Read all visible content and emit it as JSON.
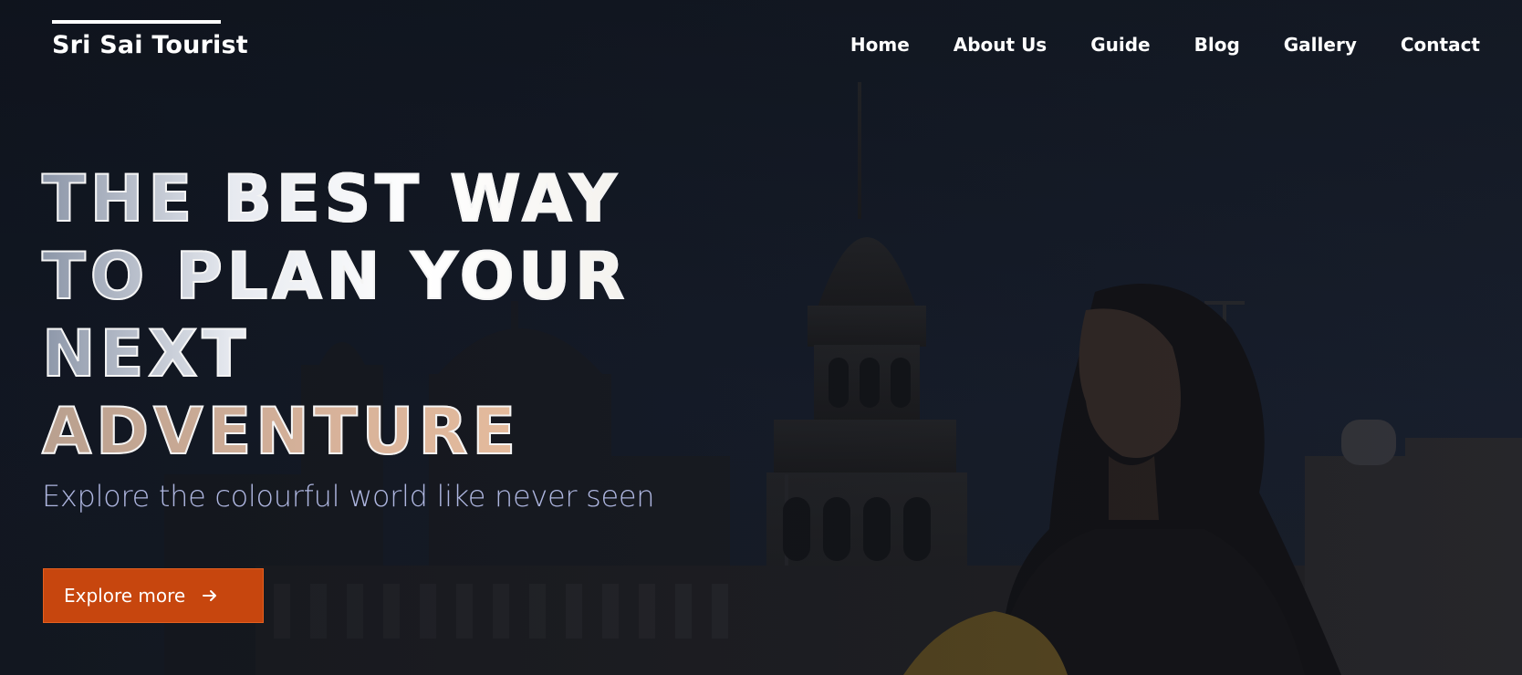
{
  "brand": {
    "name": "Sri Sai Tourist"
  },
  "nav": {
    "items": [
      {
        "label": "Home"
      },
      {
        "label": "About Us"
      },
      {
        "label": "Guide"
      },
      {
        "label": "Blog"
      },
      {
        "label": "Gallery"
      },
      {
        "label": "Contact"
      }
    ]
  },
  "hero": {
    "title_lines": [
      "THE BEST WAY",
      "TO PLAN YOUR",
      "NEXT",
      "ADVENTURE"
    ],
    "subtitle": "Explore the colourful world like never seen",
    "cta_label": "Explore more",
    "cta_icon": "arrow-right-icon"
  },
  "colors": {
    "accent": "#c7460e",
    "subtitle": "#aeb6e0",
    "background": "#0f141d"
  }
}
